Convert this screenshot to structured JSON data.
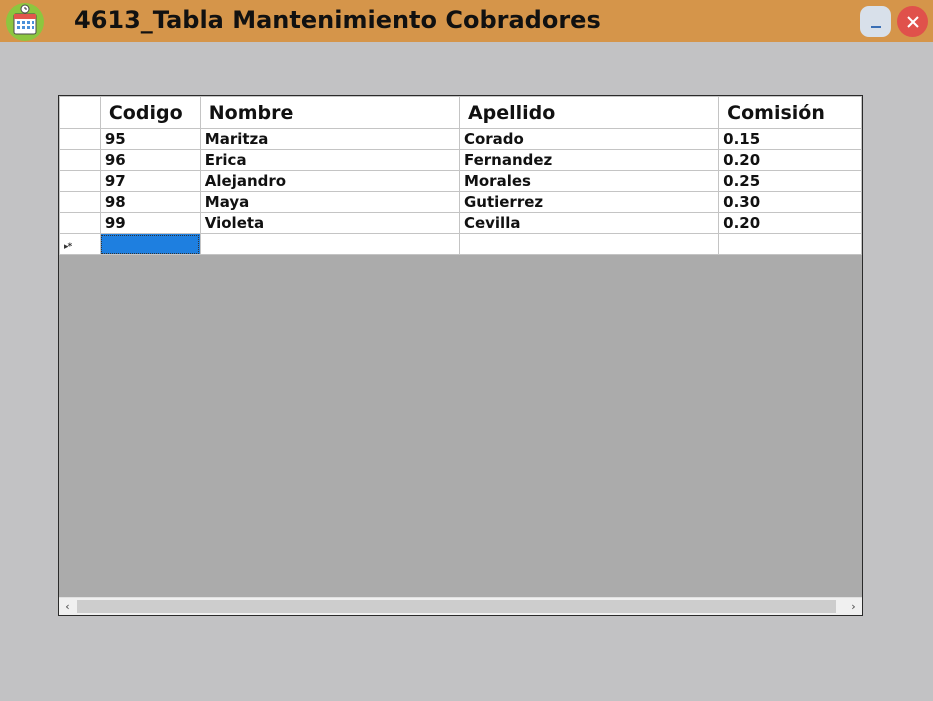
{
  "window": {
    "title": "4613_Tabla Mantenimiento Cobradores",
    "minimize_label": "_",
    "close_label": "✕"
  },
  "grid": {
    "columns": [
      "Codigo",
      "Nombre",
      "Apellido",
      "Comisión"
    ],
    "rows": [
      [
        "95",
        "Maritza",
        "Corado",
        "0.15"
      ],
      [
        "96",
        "Erica",
        "Fernandez",
        "0.20"
      ],
      [
        "97",
        "Alejandro",
        "Morales",
        "0.25"
      ],
      [
        "98",
        "Maya",
        "Gutierrez",
        "0.30"
      ],
      [
        "99",
        "Violeta",
        "Cevilla",
        "0.20"
      ]
    ],
    "new_row_marker": "▸*",
    "scroll_left": "‹",
    "scroll_right": "›"
  },
  "colors": {
    "titlebar": "#d5954a",
    "selection": "#1e7fe0",
    "grid_background": "#ababab",
    "window_background": "#c2c2c4"
  }
}
